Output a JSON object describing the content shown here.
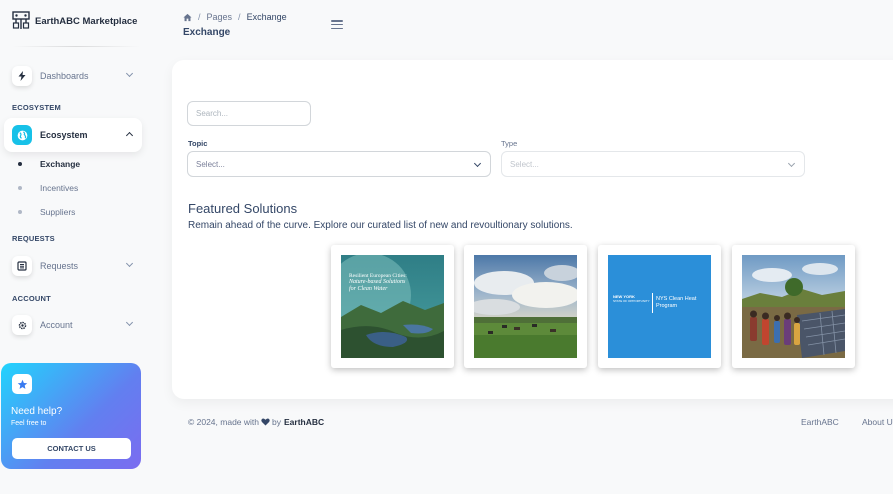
{
  "brand": {
    "name": "EarthABC Marketplace"
  },
  "sidebar": {
    "dashboards": {
      "label": "Dashboards",
      "icon": "lightning-icon"
    },
    "ecosystem_section": "ECOSYSTEM",
    "ecosystem": {
      "label": "Ecosystem",
      "icon": "globe-icon",
      "expanded": true
    },
    "sub_items": [
      {
        "label": "Exchange",
        "active": true
      },
      {
        "label": "Incentives",
        "active": false
      },
      {
        "label": "Suppliers",
        "active": false
      }
    ],
    "requests_section": "REQUESTS",
    "requests": {
      "label": "Requests",
      "icon": "list-icon"
    },
    "account_section": "ACCOUNT",
    "account": {
      "label": "Account",
      "icon": "gear-icon"
    },
    "help": {
      "title": "Need help?",
      "subtitle": "Feel free to",
      "button": "CONTACT US",
      "icon": "star-icon"
    }
  },
  "navbar": {
    "breadcrumb": [
      "Pages",
      "Exchange"
    ],
    "title": "Exchange"
  },
  "filters": {
    "search_placeholder": "Search...",
    "topic": {
      "label": "Topic",
      "value": "Select..."
    },
    "type": {
      "label": "Type",
      "value": "Select...",
      "disabled": true
    }
  },
  "featured": {
    "title": "Featured Solutions",
    "subtitle": "Remain ahead of the curve. Explore our curated list of new and revoultionary solutions.",
    "cards": [
      {
        "title_lines": [
          "Resilient European Cities:",
          "Nature-based Solutions",
          "for Clean Water"
        ]
      },
      {
        "title_lines": []
      },
      {
        "logo_text": [
          "NEW YORK",
          "STATE OF OPPORTUNITY"
        ],
        "title_lines": [
          "NYS Clean Heat",
          "Program"
        ]
      },
      {
        "title_lines": []
      }
    ]
  },
  "footer": {
    "copyright": "© 2024, made with",
    "by": "by",
    "brand": "EarthABC",
    "links": [
      "EarthABC",
      "About Us"
    ]
  },
  "colors": {
    "accent": "#17c1e8",
    "text_dark": "#344767",
    "text_muted": "#67748e",
    "nys_blue": "#2b8fd9"
  }
}
